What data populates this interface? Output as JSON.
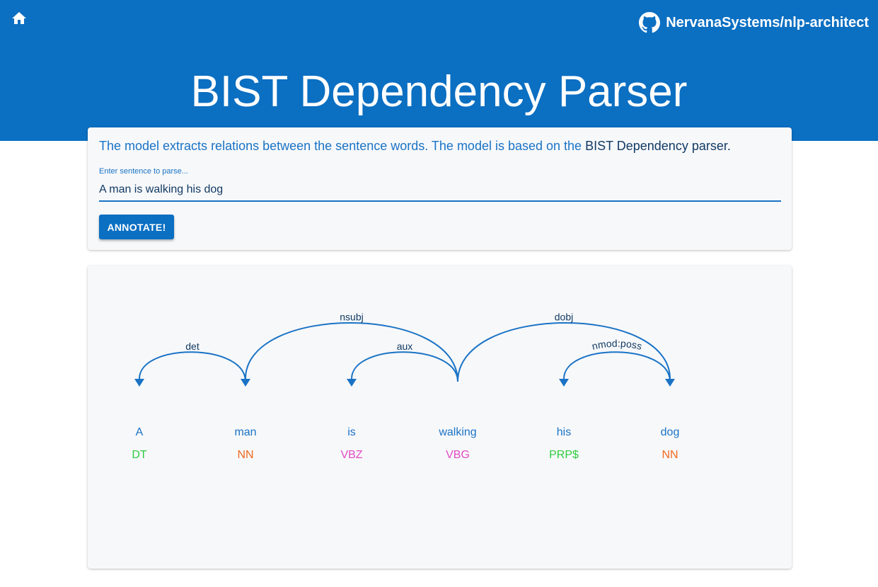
{
  "header": {
    "home_icon": "home-icon",
    "repo_icon": "github-icon",
    "repo_label": "NervanaSystems/nlp-architect",
    "title": "BIST Dependency Parser",
    "background": "#0b6fc2"
  },
  "input_card": {
    "description": "The model extracts relations between the sentence words. The model is based on the ",
    "description_link": "BIST Dependency parser.",
    "field_label": "Enter sentence to parse...",
    "field_value": "A man is walking his dog",
    "button_label": "ANNOTATE!"
  },
  "parse": {
    "words": [
      {
        "text": "A",
        "tag": "DT",
        "tag_color": "#2ecc40"
      },
      {
        "text": "man",
        "tag": "NN",
        "tag_color": "#f06a1d"
      },
      {
        "text": "is",
        "tag": "VBZ",
        "tag_color": "#e24ac4"
      },
      {
        "text": "walking",
        "tag": "VBG",
        "tag_color": "#e24ac4"
      },
      {
        "text": "his",
        "tag": "PRP$",
        "tag_color": "#2ecc40"
      },
      {
        "text": "dog",
        "tag": "NN",
        "tag_color": "#f06a1d"
      }
    ],
    "arcs": [
      {
        "label": "det",
        "head": 1,
        "dep": 0
      },
      {
        "label": "nsubj",
        "head": 3,
        "dep": 1
      },
      {
        "label": "aux",
        "head": 3,
        "dep": 2
      },
      {
        "label": "dobj",
        "head": 3,
        "dep": 5
      },
      {
        "label": "nmod:poss",
        "head": 5,
        "dep": 4
      }
    ],
    "word_color": "#1a73c5",
    "arc_color": "#1a73c5",
    "label_color": "#123a63"
  }
}
